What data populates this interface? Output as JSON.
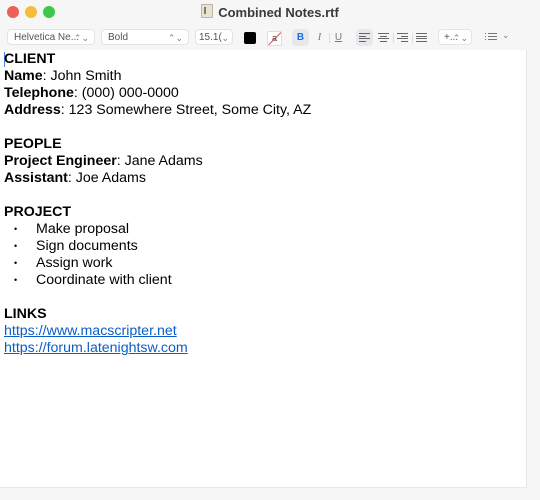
{
  "window": {
    "title": "Combined Notes.rtf"
  },
  "toolbar": {
    "font_family": "Helvetica Ne...",
    "font_style": "Bold",
    "font_size": "15.1(",
    "text_color": "#000000",
    "bold_label": "B",
    "italic_label": "I",
    "underline_label": "U",
    "bold_active": true,
    "alignment": "left",
    "spacing_label": "+...",
    "bg_color_label": "a"
  },
  "document": {
    "client": {
      "heading": "CLIENT",
      "name_label": "Name",
      "name_value": ": John Smith",
      "telephone_label": "Telephone",
      "telephone_value": ": (000) 000-0000",
      "address_label": "Address",
      "address_value": ": 123 Somewhere Street, Some City, AZ"
    },
    "people": {
      "heading": "PEOPLE",
      "engineer_label": "Project Engineer",
      "engineer_value": ": Jane Adams",
      "assistant_label": "Assistant",
      "assistant_value": ": Joe Adams"
    },
    "project": {
      "heading": "PROJECT",
      "bullet_glyph": "•",
      "items": [
        "Make proposal",
        "Sign documents",
        "Assign work",
        "Coordinate with client"
      ]
    },
    "links": {
      "heading": "LINKS",
      "items": [
        "https://www.macscripter.net",
        "https://forum.latenightsw.com"
      ]
    }
  }
}
